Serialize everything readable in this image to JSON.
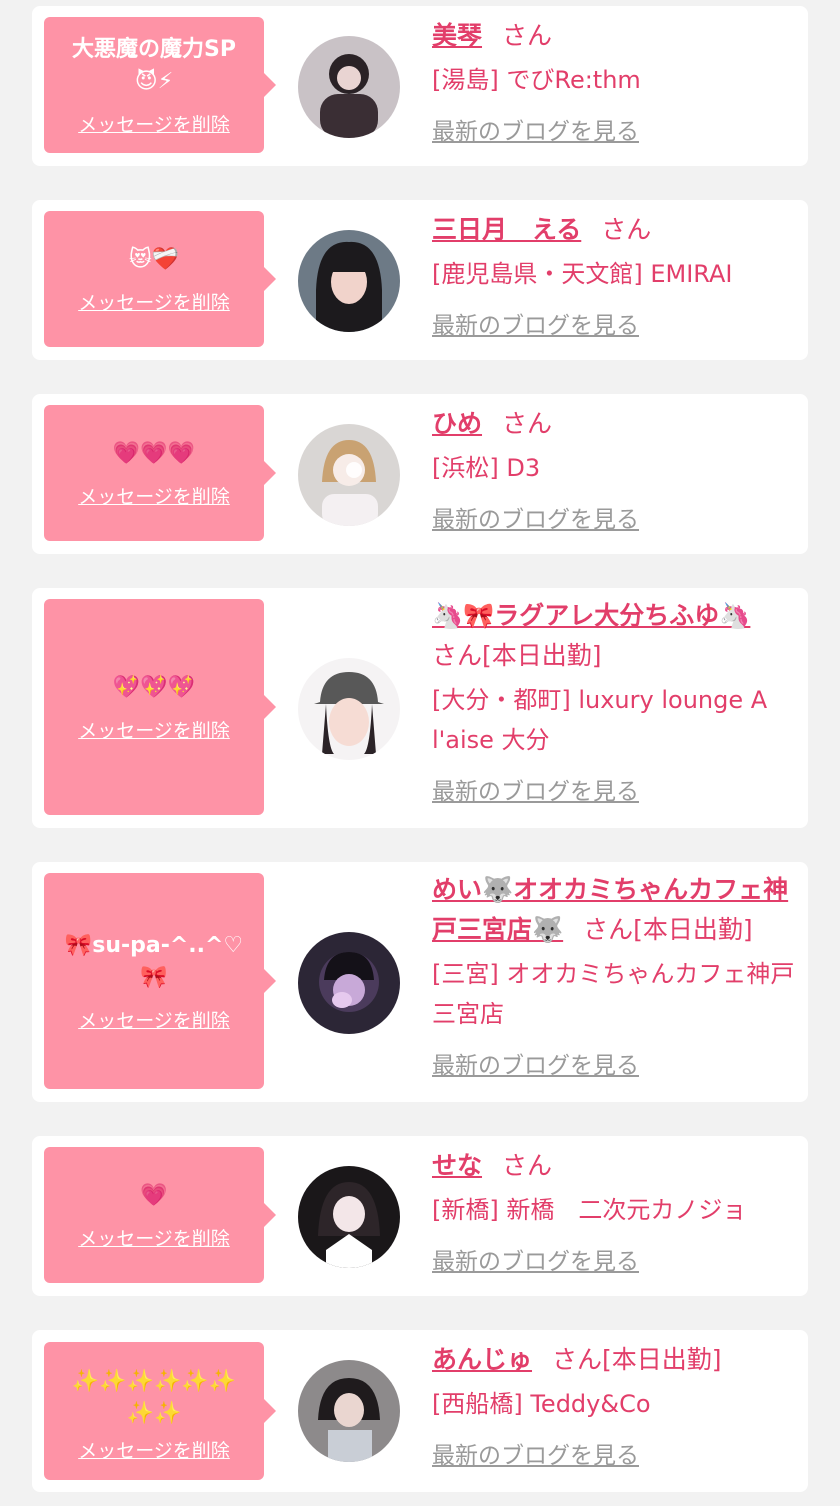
{
  "delete_label": "メッセージを削除",
  "blog_label": "最新のブログを見る",
  "san": "さん",
  "colors": {
    "accent": "#e23e6a",
    "bubble": "#fe93a6",
    "card": "#ffffff",
    "page": "#f2f2f2",
    "link_gray": "#9a9a9a"
  },
  "items": [
    {
      "message": "大悪魔の魔力SP\n😈⚡",
      "name": "美琴",
      "suffix": "",
      "shop": "[湯島] でびRe:thm"
    },
    {
      "message": "😻❤️‍🩹",
      "name": "三日月　える",
      "suffix": "",
      "shop": "[鹿児島県・天文館] EMIRAI"
    },
    {
      "message": "💗💗💗",
      "name": "ひめ",
      "suffix": "",
      "shop": "[浜松] D3"
    },
    {
      "message": "💖💖💖",
      "name": "🦄🎀ラグアレ大分ちふゆ🦄",
      "suffix": "[本日出勤]",
      "shop": "[大分・都町] luxury lounge A l'aise 大分"
    },
    {
      "message": "🎀su-pa-^..^♡🎀",
      "name": "めい🐺オオカミちゃんカフェ神戸三宮店🐺",
      "suffix": "[本日出勤]",
      "shop": "[三宮] オオカミちゃんカフェ神戸三宮店"
    },
    {
      "message": "💗",
      "name": "せな",
      "suffix": "",
      "shop": "[新橋] 新橋　二次元カノジョ"
    },
    {
      "message": "✨✨✨✨✨✨\n✨✨",
      "name": "あんじゅ",
      "suffix": "[本日出勤]",
      "shop": "[西船橋] Teddy&Co"
    }
  ]
}
